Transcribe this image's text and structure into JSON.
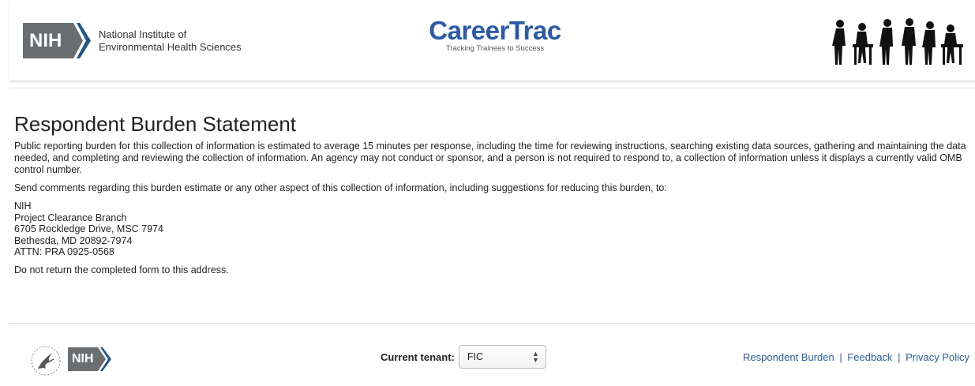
{
  "header": {
    "nih_badge": "NIH",
    "institute_line1": "National Institute of",
    "institute_line2": "Environmental Health Sciences",
    "brand_title": "CareerTrac",
    "brand_tagline": "Tracking Trainees to Success",
    "people_icon": "people-silhouettes-icon"
  },
  "main": {
    "title": "Respondent Burden Statement",
    "paragraph1": "Public reporting burden for this collection of information is estimated to average 15 minutes per response, including the time for reviewing instructions, searching existing data sources, gathering and maintaining the data needed, and completing and reviewing the collection of information. An agency may not conduct or sponsor, and a person is not required to respond to, a collection of information unless it displays a currently valid OMB control number.",
    "paragraph2": "Send comments regarding this burden estimate or any other aspect of this collection of information, including suggestions for reducing this burden, to:",
    "address": [
      "NIH",
      "Project Clearance Branch",
      "6705 Rockledge Drive, MSC 7974",
      "Bethesda, MD 20892-7974",
      "ATTN: PRA 0925-0568"
    ],
    "note": "Do not return the completed form to this address."
  },
  "footer": {
    "hhs_icon": "hhs-eagle-icon",
    "nih_badge": "NIH",
    "tenant_label": "Current tenant:",
    "tenant_value": "FIC",
    "links": [
      "Respondent Burden",
      "Feedback",
      "Privacy Policy"
    ],
    "separator": "|"
  },
  "colors": {
    "brand_blue": "#2b5aa8",
    "link_blue": "#2c5d9e",
    "nih_gray": "#6b6e70",
    "nih_blue": "#20558a"
  }
}
